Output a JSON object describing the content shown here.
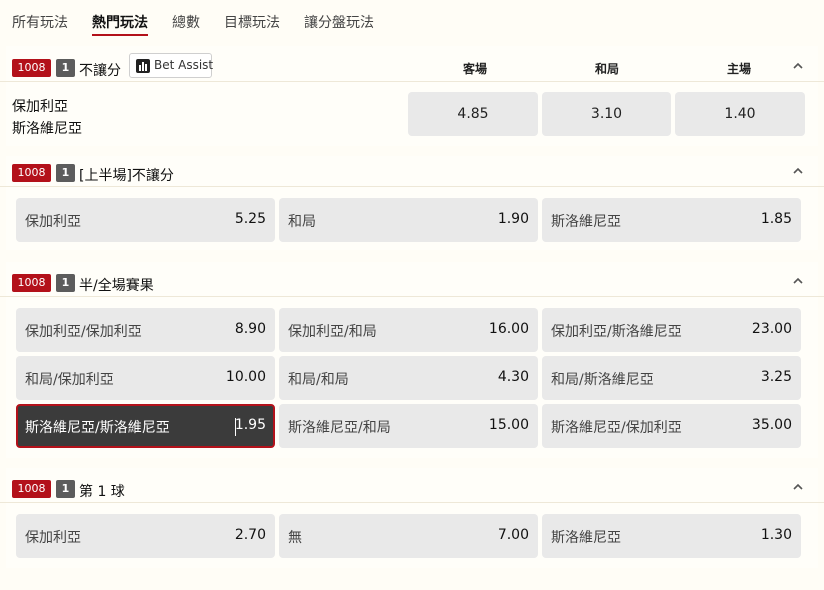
{
  "tabs": [
    {
      "label": "所有玩法"
    },
    {
      "label": "熱門玩法"
    },
    {
      "label": "總數"
    },
    {
      "label": "目標玩法"
    },
    {
      "label": "讓分盤玩法"
    }
  ],
  "active_tab": "熱門玩法",
  "colors": {
    "accent": "#b3111a",
    "badge_grey": "#5c5c5c",
    "cell_bg": "#e9e9e9",
    "selected_bg": "#3b3b3b"
  },
  "markets": [
    {
      "id": "1008",
      "count": "1",
      "title": "不讓分",
      "bet_assist": "Bet Assist",
      "columns": [
        "客場",
        "和局",
        "主場"
      ],
      "teams": [
        "保加利亞",
        "斯洛維尼亞"
      ],
      "odds": [
        "4.85",
        "3.10",
        "1.40"
      ]
    },
    {
      "id": "1008",
      "count": "1",
      "title": "[上半場]不讓分",
      "cells": [
        {
          "label": "保加利亞",
          "odds": "5.25"
        },
        {
          "label": "和局",
          "odds": "1.90"
        },
        {
          "label": "斯洛維尼亞",
          "odds": "1.85"
        }
      ]
    },
    {
      "id": "1008",
      "count": "1",
      "title": "半/全場賽果",
      "cells": [
        {
          "label": "保加利亞/保加利亞",
          "odds": "8.90"
        },
        {
          "label": "保加利亞/和局",
          "odds": "16.00"
        },
        {
          "label": "保加利亞/斯洛維尼亞",
          "odds": "23.00"
        },
        {
          "label": "和局/保加利亞",
          "odds": "10.00"
        },
        {
          "label": "和局/和局",
          "odds": "4.30"
        },
        {
          "label": "和局/斯洛維尼亞",
          "odds": "3.25"
        },
        {
          "label": "斯洛維尼亞/斯洛維尼亞",
          "odds": "1.95",
          "selected": true
        },
        {
          "label": "斯洛維尼亞/和局",
          "odds": "15.00"
        },
        {
          "label": "斯洛維尼亞/保加利亞",
          "odds": "35.00"
        }
      ]
    },
    {
      "id": "1008",
      "count": "1",
      "title": "第 1 球",
      "cells": [
        {
          "label": "保加利亞",
          "odds": "2.70"
        },
        {
          "label": "無",
          "odds": "7.00"
        },
        {
          "label": "斯洛維尼亞",
          "odds": "1.30"
        }
      ]
    }
  ]
}
